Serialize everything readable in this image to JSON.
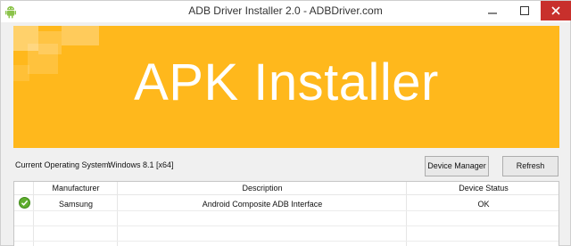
{
  "window": {
    "title": "ADB Driver Installer 2.0 - ADBDriver.com",
    "app_icon": "android-icon",
    "controls": [
      "minimize-icon",
      "maximize-icon",
      "close-icon"
    ]
  },
  "banner": {
    "title": "APK Installer",
    "background_color": "#ffb81c"
  },
  "system": {
    "label": "Current Operating System:",
    "value": "Windows 8.1  [x64]"
  },
  "buttons": {
    "device_manager": "Device Manager",
    "refresh": "Refresh"
  },
  "table": {
    "columns": [
      "Manufacturer",
      "Description",
      "Device Status"
    ],
    "rows": [
      {
        "status_icon": "check-circle-icon",
        "manufacturer": "Samsung",
        "description": "Android Composite ADB Interface",
        "device_status": "OK"
      }
    ]
  }
}
